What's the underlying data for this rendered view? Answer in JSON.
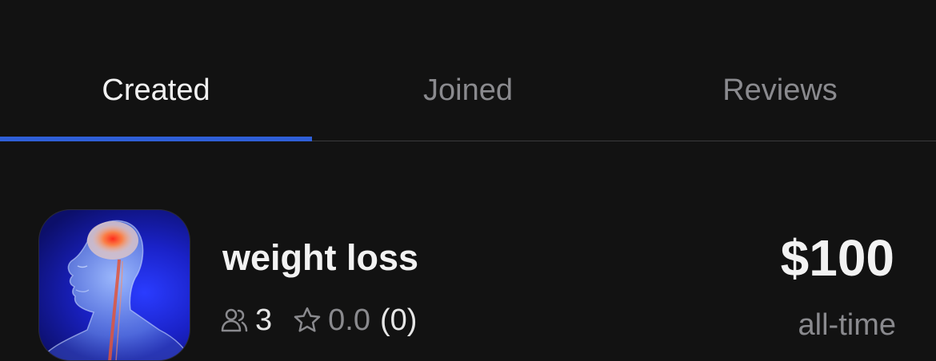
{
  "tabs": [
    {
      "label": "Created",
      "active": true
    },
    {
      "label": "Joined",
      "active": false
    },
    {
      "label": "Reviews",
      "active": false
    }
  ],
  "colors": {
    "background": "#121212",
    "accent": "#2f5fd7",
    "text_primary": "#f2f2f2",
    "text_secondary": "#8a8a8e"
  },
  "challenge": {
    "title": "weight loss",
    "members_icon": "people-icon",
    "members": "3",
    "rating_icon": "star-outline-icon",
    "rating": "0.0",
    "review_count": "(0)",
    "price": "$100",
    "price_period": "all-time",
    "thumbnail_icon": "anatomy-head-brain-image"
  }
}
